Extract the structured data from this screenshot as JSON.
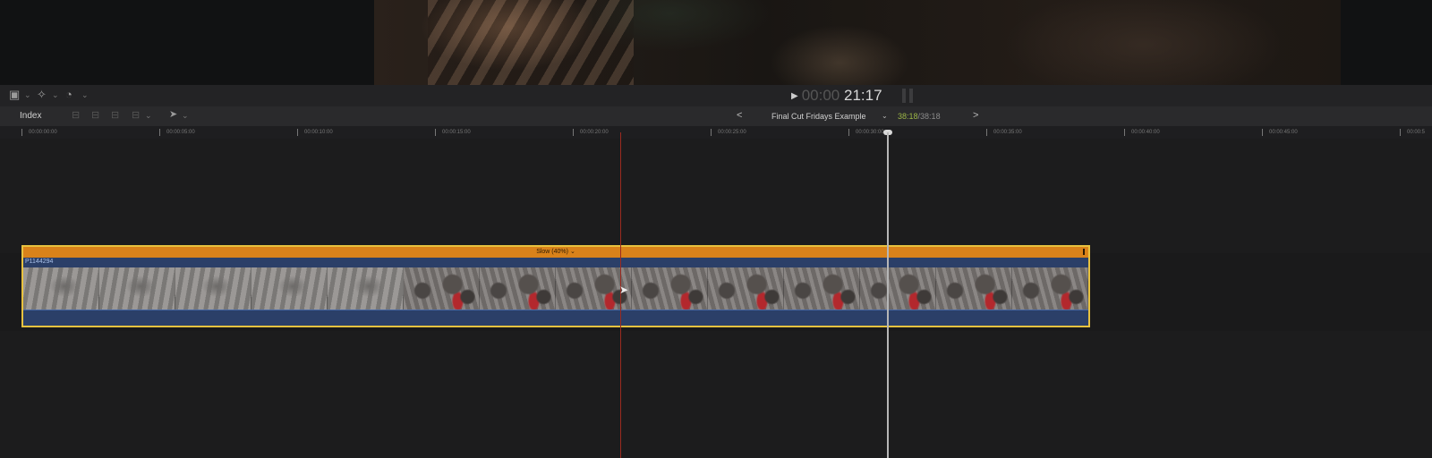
{
  "toolbar": {
    "index_label": "Index",
    "timecode_prefix": "00:00",
    "timecode_value": "21:17"
  },
  "project": {
    "name": "Final Cut Fridays Example",
    "duration_current": "38:18",
    "duration_separator": "/",
    "duration_total": "38:18"
  },
  "ruler": {
    "labels": [
      "00:00:00:00",
      "00:00:05:00",
      "00:00:10:00",
      "00:00:15:00",
      "00:00:20:00",
      "00:00:25:00",
      "00:00:30:00",
      "00:00:35:00",
      "00:00:40:00",
      "00:00:45:00",
      "00:00:5"
    ]
  },
  "clip": {
    "name": "P1144294",
    "retime_label": "Slow (40%)",
    "retime_caret": "⌄"
  },
  "colors": {
    "retime_bar": "#d9821a",
    "selection": "#e8c23f",
    "clip_body": "#2b3f68",
    "playhead": "#9b2a20",
    "duration_current": "#9bb546"
  },
  "icons": {
    "select_tool": "square-select-icon",
    "blade_tool": "magic-wand-icon",
    "speed_tool": "speedometer-icon",
    "arrow_tool": "arrow-cursor-icon"
  }
}
